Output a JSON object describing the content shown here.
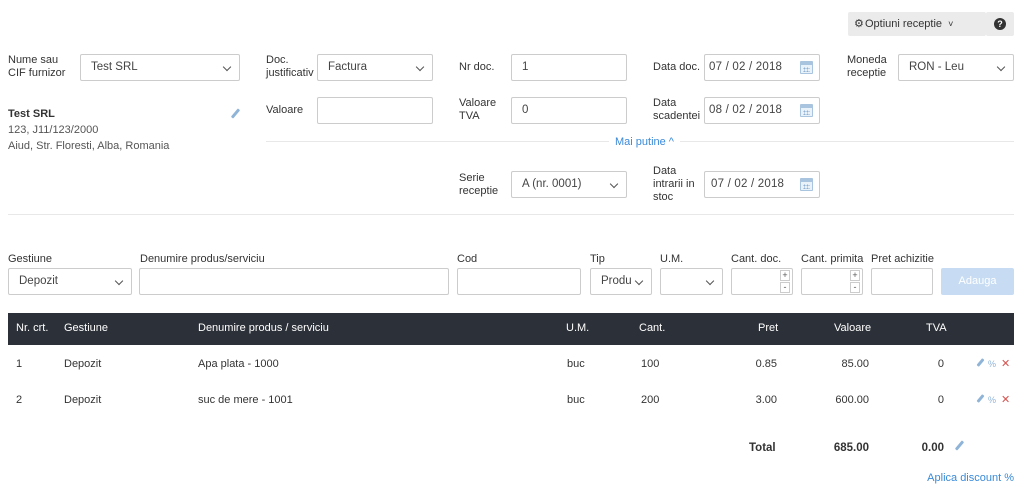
{
  "top_buttons": {
    "options_label": "Optiuni receptie",
    "options_chevron": "˅"
  },
  "header": {
    "supplier_label": "Nume sau CIF furnizor",
    "supplier_value": "Test SRL",
    "doc_type_label": "Doc. justificativ",
    "doc_type_value": "Factura",
    "doc_no_label": "Nr doc.",
    "doc_no_value": "1",
    "doc_date_label": "Data doc.",
    "doc_date_value": "07 / 02 / 2018",
    "currency_label": "Moneda receptie",
    "currency_value": "RON - Leu",
    "value_label": "Valoare",
    "value_value": "",
    "vat_label": "Valoare TVA",
    "vat_value": "0",
    "due_label": "Data scadentei",
    "due_value": "08 / 02 / 2018",
    "less_link": "Mai putine ^",
    "series_label": "Serie receptie",
    "series_value": "A (nr. 0001)",
    "stock_date_label": "Data intrarii in stoc",
    "stock_date_value": "07 / 02 / 2018"
  },
  "supplier_card": {
    "name": "Test SRL",
    "reg": "123, J11/123/2000",
    "address": "Aiud, Str. Floresti, Alba, Romania"
  },
  "add_row": {
    "gestiune_label": "Gestiune",
    "gestiune_value": "Depozit",
    "product_label": "Denumire produs/serviciu",
    "code_label": "Cod",
    "type_label": "Tip",
    "type_value": "Produ",
    "um_label": "U.M.",
    "qty_doc_label": "Cant. doc.",
    "qty_recv_label": "Cant. primita",
    "price_label": "Pret achizitie",
    "add_button": "Adauga"
  },
  "table": {
    "headers": [
      "Nr. crt.",
      "Gestiune",
      "Denumire produs / serviciu",
      "U.M.",
      "Cant.",
      "Pret",
      "Valoare",
      "TVA"
    ],
    "rows": [
      {
        "nr": "1",
        "gestiune": "Depozit",
        "produs": "Apa plata - 1000",
        "um": "buc",
        "cant": "100",
        "pret": "0.85",
        "valoare": "85.00",
        "tva": "0"
      },
      {
        "nr": "2",
        "gestiune": "Depozit",
        "produs": "suc de mere - 1001",
        "um": "buc",
        "cant": "200",
        "pret": "3.00",
        "valoare": "600.00",
        "tva": "0"
      }
    ],
    "total_label": "Total",
    "total_value": "685.00",
    "total_vat": "0.00",
    "discount_link": "Aplica discount %"
  },
  "colors": {
    "header_bg": "#2c3038",
    "link": "#3a8ad8",
    "delete": "#d9534f",
    "add_button_bg": "#c7dcf2"
  },
  "icons": [
    "gear-icon",
    "question-icon",
    "chevron-down-icon",
    "calendar-icon",
    "pencil-icon",
    "percent-icon",
    "delete-icon"
  ]
}
